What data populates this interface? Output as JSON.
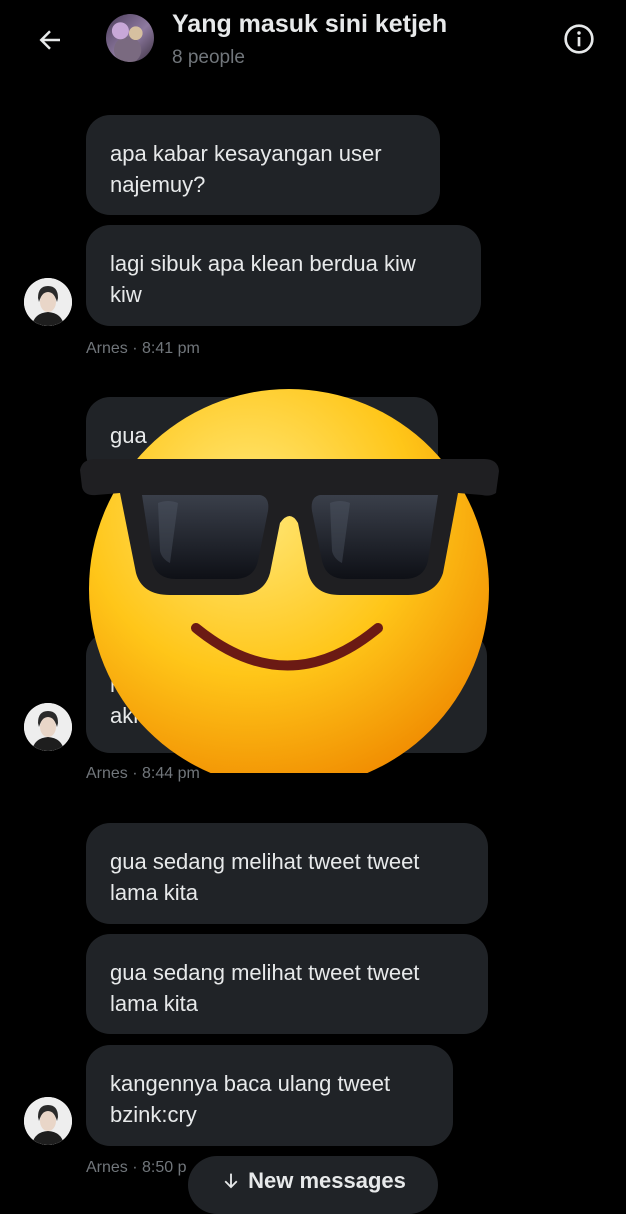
{
  "header": {
    "title": "Yang masuk sini ketjeh",
    "subtitle": "8 people"
  },
  "messages": [
    {
      "text_line1": "apa kabar kesayangan user",
      "text_line2": "najemuy?"
    },
    {
      "text_line1": "lagi sibuk apa klean berdua kiw",
      "text_line2": "kiw"
    },
    {
      "meta": "Arnes · 8:41 pm"
    },
    {
      "text_line1": "gua"
    },
    {
      "text_line1": "m",
      "tail": "r",
      "text_line2": "akh"
    },
    {
      "meta": "Arnes · 8:44 pm"
    },
    {
      "text_line1": "gua sedang melihat tweet tweet",
      "text_line2": "lama kita"
    },
    {
      "text_line1": "gua sedang melihat tweet tweet",
      "text_line2": "lama kita"
    },
    {
      "text_line1": "kangennya baca ulang tweet",
      "text_line2": "bzink:cry"
    },
    {
      "meta": "Arnes · 8:50 p"
    }
  ],
  "new_messages_label": "New messages",
  "icons": {
    "back": "back-arrow-icon",
    "info": "info-icon",
    "down": "arrow-down-icon",
    "sticker": "sunglasses-face-emoji"
  }
}
